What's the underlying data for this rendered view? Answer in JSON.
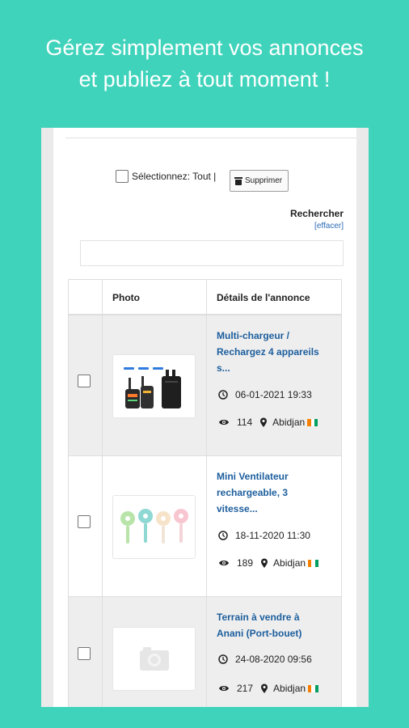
{
  "headline": {
    "line1": "Gérez simplement vos annonces",
    "line2": "et publiez à tout moment !"
  },
  "toolbar": {
    "select_all_label": "Sélectionnez: Tout |",
    "delete_label": "Supprimer"
  },
  "search": {
    "label": "Rechercher",
    "clear_label": "[effacer]",
    "value": ""
  },
  "table": {
    "headers": [
      "Photo",
      "Détails de l'annonce"
    ],
    "rows": [
      {
        "title_lines": [
          "Multi-chargeur /",
          "Rechargez 4 appareils",
          "s..."
        ],
        "date": "06-01-2021 19:33",
        "views": "114",
        "location": "Abidjan",
        "photo_icon": "charger-photo",
        "row_tint": "#eeeeee"
      },
      {
        "title_lines": [
          "Mini Ventilateur",
          "rechargeable, 3",
          "vitesse..."
        ],
        "date": "18-11-2020 11:30",
        "views": "189",
        "location": "Abidjan",
        "photo_icon": "fan-photo",
        "row_tint": "#ffffff"
      },
      {
        "title_lines": [
          "Terrain à vendre à",
          "Anani (Port-bouet)"
        ],
        "date": "24-08-2020 09:56",
        "views": "217",
        "location": "Abidjan",
        "photo_icon": "camera-placeholder-icon",
        "row_tint": "#eeeeee"
      }
    ]
  },
  "icons": {
    "date": "clock-icon",
    "views": "eye-icon",
    "location": "map-pin-icon",
    "flag": "ivory-coast-flag-icon"
  },
  "colors": {
    "background": "#40d3bb",
    "link": "#1c5e9d",
    "clear_link": "#2a6bb5",
    "flag_orange": "#f77f00",
    "flag_white": "#ffffff",
    "flag_green": "#009e60"
  }
}
